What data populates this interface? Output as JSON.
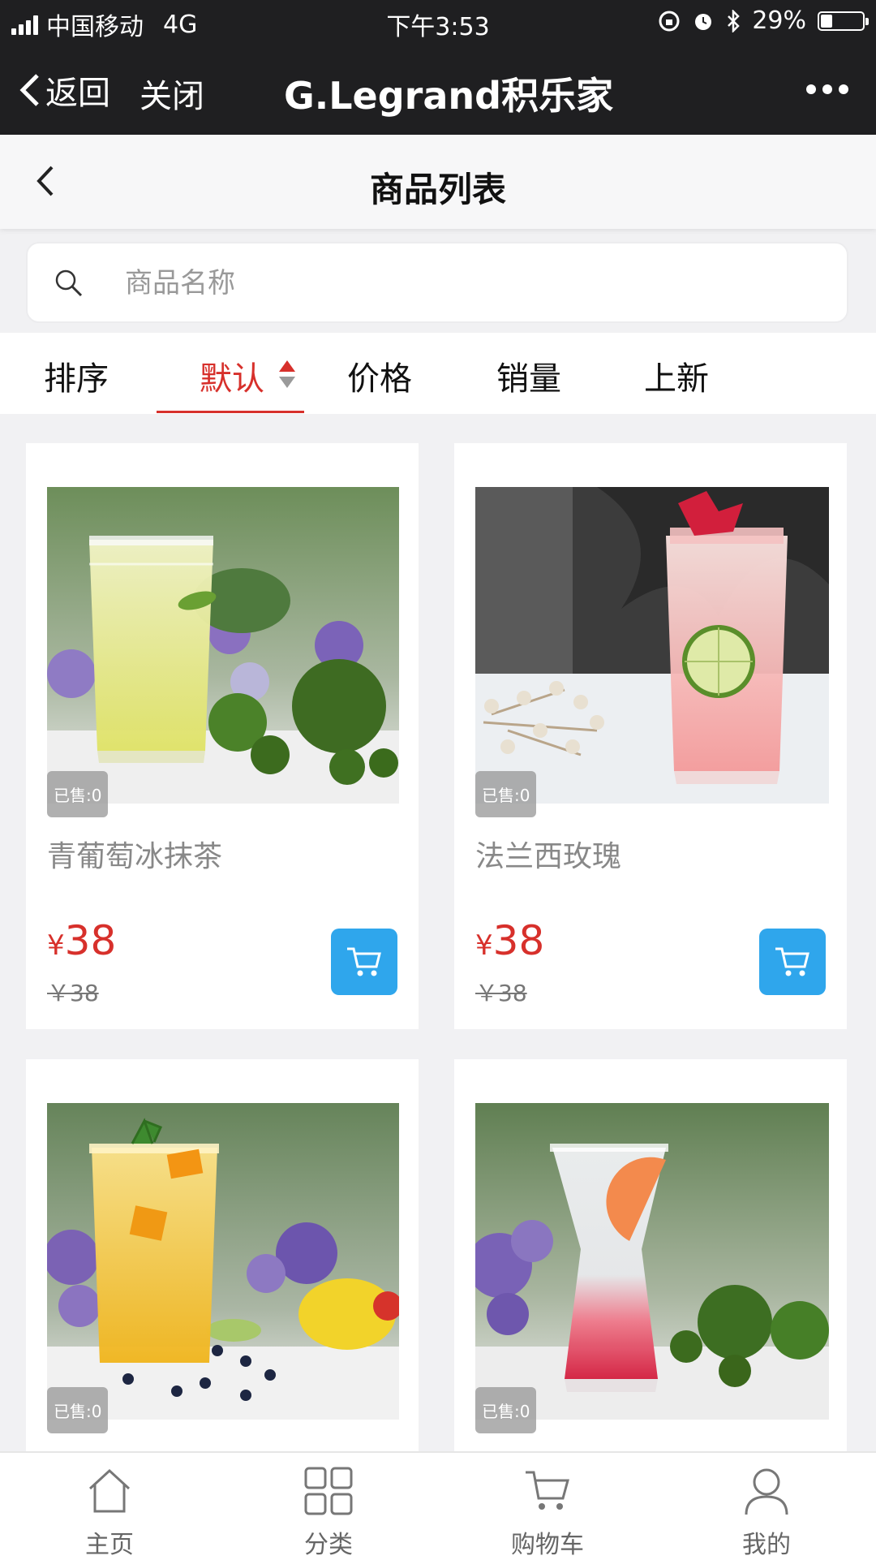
{
  "status_bar": {
    "carrier": "中国移动",
    "network": "4G",
    "time": "下午3:53",
    "battery": "29%",
    "battery_level": 0.29
  },
  "wechat_bar": {
    "back_label": "返回",
    "close_label": "关闭",
    "title": "G.Legrand积乐家"
  },
  "page": {
    "title": "商品列表"
  },
  "search": {
    "placeholder": "商品名称",
    "value": ""
  },
  "sort": {
    "label": "排序",
    "options": [
      "默认",
      "价格",
      "销量",
      "上新"
    ],
    "active": "默认"
  },
  "products": [
    {
      "sold": "已售:0",
      "name": "青葡萄冰抹茶",
      "price_symbol": "¥",
      "price": "38",
      "original_price": "￥38"
    },
    {
      "sold": "已售:0",
      "name": "法兰西玫瑰",
      "price_symbol": "¥",
      "price": "38",
      "original_price": "￥38"
    },
    {
      "sold": "已售:0"
    },
    {
      "sold": "已售:0"
    }
  ],
  "tabbar": [
    {
      "label": "主页",
      "icon": "home-icon"
    },
    {
      "label": "分类",
      "icon": "grid-icon"
    },
    {
      "label": "购物车",
      "icon": "cart-icon"
    },
    {
      "label": "我的",
      "icon": "user-icon"
    }
  ],
  "colors": {
    "accent": "#d7302b",
    "cart_button": "#2fa6ec",
    "topbar": "#1f1f21"
  }
}
